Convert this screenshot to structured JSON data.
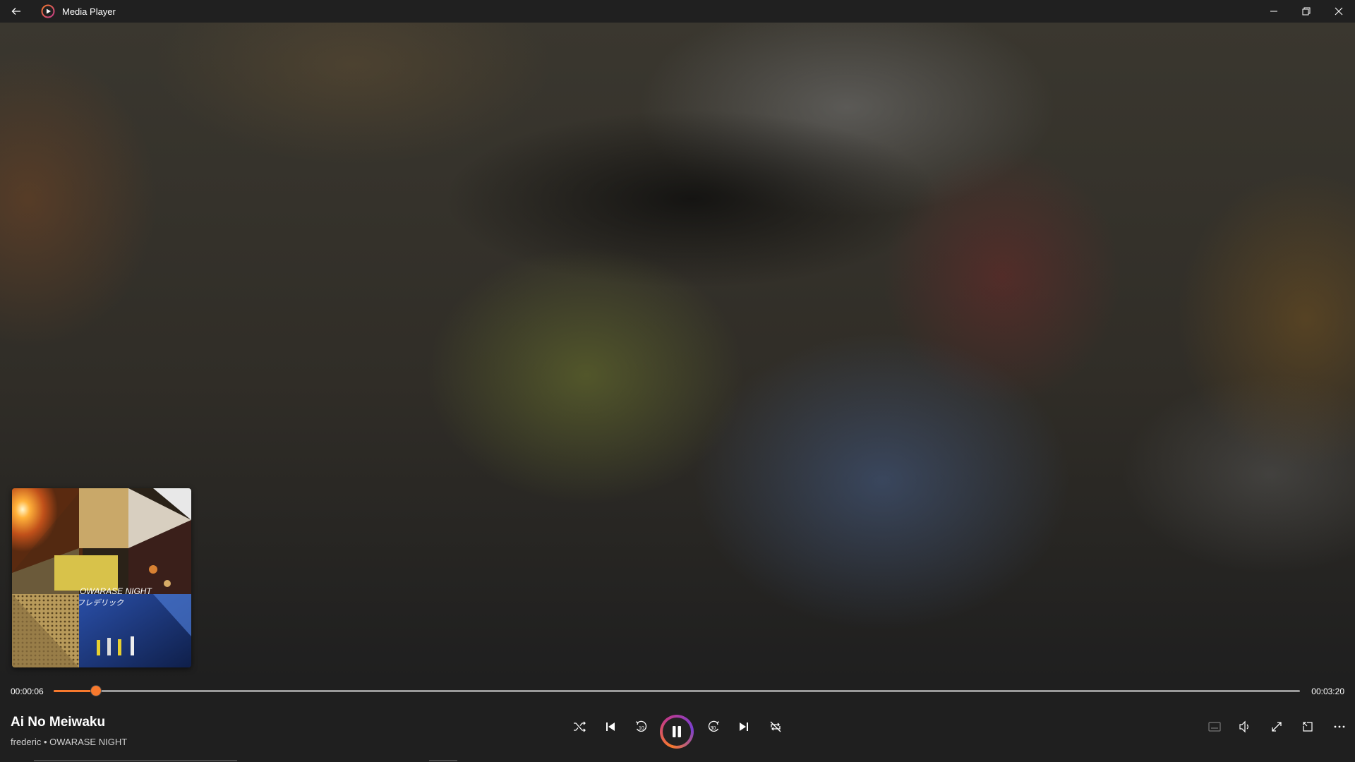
{
  "window": {
    "title": "Media Player",
    "icons": {
      "back": "back-arrow-icon",
      "app": "media-player-app-icon",
      "minimize": "minimize-icon",
      "restore": "restore-icon",
      "close": "close-icon"
    }
  },
  "now_playing": {
    "title": "Ai No Meiwaku",
    "artist_album": "frederic • OWARASE NIGHT",
    "album_art_text": [
      "OWARASE NIGHT",
      "フレデリック"
    ]
  },
  "seek": {
    "current_time": "00:00:06",
    "duration": "00:03:20",
    "progress_fraction": 0.034
  },
  "transport": {
    "shuffle": "shuffle-icon",
    "previous": "previous-track-icon",
    "rewind": "rewind-10-icon",
    "rewind_label": "10",
    "play_pause": "pause-icon",
    "forward": "forward-30-icon",
    "forward_label": "30",
    "next": "next-track-icon",
    "repeat": "repeat-off-icon"
  },
  "right_controls": [
    "captions-icon",
    "volume-icon",
    "fullscreen-icon",
    "mini-player-icon",
    "more-options-icon"
  ],
  "colors": {
    "accent": "#f7792d",
    "title_bar": "#202020",
    "panel": "#1f1f1f"
  }
}
